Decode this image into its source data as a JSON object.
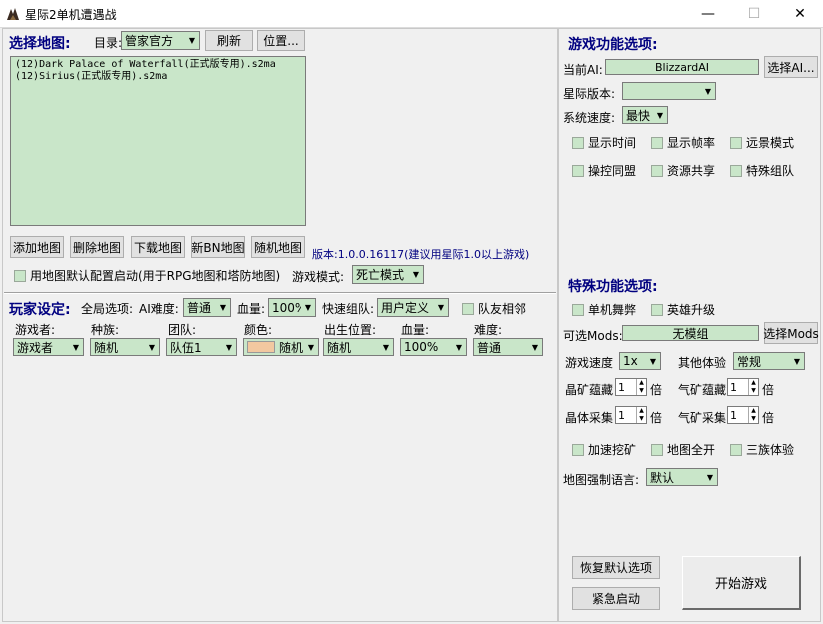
{
  "window": {
    "title": "星际2单机遭遇战",
    "minimize": "—",
    "maximize": "☐",
    "close": "✕"
  },
  "map_select": {
    "heading": "选择地图:",
    "dir_label": "目录:",
    "dir_value": "管家官方",
    "refresh": "刷新",
    "location": "位置...",
    "maps": [
      "(12)Dark Palace of Waterfall(正式版专用).s2ma",
      "(12)Sirius(正式版专用).s2ma"
    ],
    "buttons": {
      "add": "添加地图",
      "delete": "删除地图",
      "download": "下载地图",
      "new_bn": "新BN地图",
      "random": "随机地图"
    },
    "version_text": "版本:1.0.0.16117(建议用星际1.0以上游戏)",
    "default_config_label": "用地图默认配置启动(用于RPG地图和塔防地图)",
    "game_mode_label": "游戏模式:",
    "game_mode_value": "死亡模式"
  },
  "players": {
    "heading": "玩家设定:",
    "global_label": "全局选项:",
    "ai_diff_label": "AI难度:",
    "ai_diff_value": "普通",
    "hp_label": "血量:",
    "hp_value": "100%",
    "quick_team_label": "快速组队:",
    "quick_team_value": "用户定义",
    "ally_label": "队友相邻",
    "columns": [
      "游戏者:",
      "种族:",
      "团队:",
      "颜色:",
      "出生位置:",
      "血量:",
      "难度:"
    ],
    "row": {
      "player": "游戏者",
      "race": "随机",
      "team": "队伍1",
      "color": "随机",
      "spawn": "随机",
      "hp": "100%",
      "difficulty": "普通"
    }
  },
  "game_options": {
    "heading": "游戏功能选项:",
    "current_ai_label": "当前AI:",
    "current_ai_value": "BlizzardAI",
    "select_ai": "选择AI...",
    "version_label": "星际版本:",
    "version_value": "",
    "speed_label": "系统速度:",
    "speed_value": "最快",
    "checks": [
      "显示时间",
      "显示帧率",
      "远景模式",
      "操控同盟",
      "资源共享",
      "特殊组队"
    ]
  },
  "special_options": {
    "heading": "特殊功能选项:",
    "checks_top": [
      "单机舞弊",
      "英雄升级"
    ],
    "mods_label": "可选Mods:",
    "mods_value": "无模组",
    "select_mods": "选择Mods",
    "game_speed_label": "游戏速度",
    "game_speed_value": "1x",
    "other_label": "其他体验",
    "other_value": "常规",
    "mineral_deposit_label": "晶矿蕴藏",
    "mineral_deposit_value": "1",
    "gas_deposit_label": "气矿蕴藏",
    "gas_deposit_value": "1",
    "mineral_gather_label": "晶体采集",
    "mineral_gather_value": "1",
    "gas_gather_label": "气矿采集",
    "gas_gather_value": "1",
    "unit_times": "倍",
    "checks_bottom": [
      "加速挖矿",
      "地图全开",
      "三族体验"
    ],
    "lang_label": "地图强制语言:",
    "lang_value": "默认"
  },
  "actions": {
    "restore": "恢复默认选项",
    "emergency": "紧急启动",
    "start": "开始游戏"
  }
}
